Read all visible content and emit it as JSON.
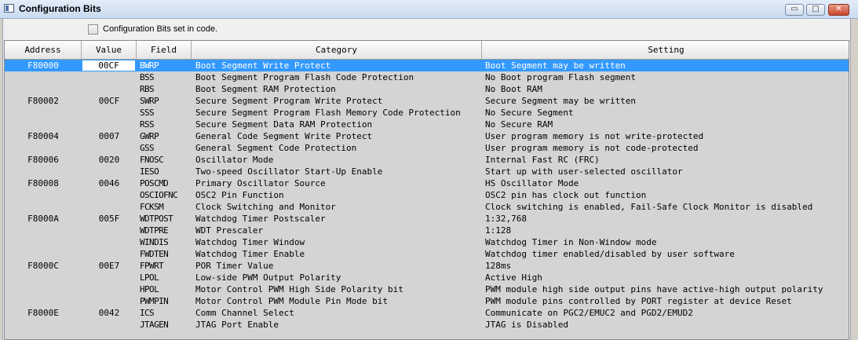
{
  "window": {
    "title": "Configuration Bits",
    "buttons": [
      "▭",
      "□",
      "✕"
    ]
  },
  "options": {
    "config_in_code_label": "Configuration Bits set in code.",
    "config_in_code_checked": false
  },
  "table": {
    "columns": [
      "Address",
      "Value",
      "Field",
      "Category",
      "Setting"
    ],
    "selected_row": 0,
    "rows": [
      {
        "address": "F80000",
        "value": "00CF",
        "field": "BWRP",
        "category": "Boot Segment Write Protect",
        "setting": "Boot Segment may be written"
      },
      {
        "address": "",
        "value": "",
        "field": "BSS",
        "category": "Boot Segment Program Flash Code Protection",
        "setting": "No Boot program Flash segment"
      },
      {
        "address": "",
        "value": "",
        "field": "RBS",
        "category": "Boot Segment RAM Protection",
        "setting": "No Boot RAM"
      },
      {
        "address": "F80002",
        "value": "00CF",
        "field": "SWRP",
        "category": "Secure Segment Program Write Protect",
        "setting": "Secure Segment may be written"
      },
      {
        "address": "",
        "value": "",
        "field": "SSS",
        "category": "Secure Segment Program Flash Memory Code Protection",
        "setting": "No Secure Segment"
      },
      {
        "address": "",
        "value": "",
        "field": "RSS",
        "category": "Secure Segment Data RAM Protection",
        "setting": "No Secure RAM"
      },
      {
        "address": "F80004",
        "value": "0007",
        "field": "GWRP",
        "category": "General Code Segment Write Protect",
        "setting": "User program memory is not write-protected"
      },
      {
        "address": "",
        "value": "",
        "field": "GSS",
        "category": "General Segment Code Protection",
        "setting": "User program memory is not code-protected"
      },
      {
        "address": "F80006",
        "value": "0020",
        "field": "FNOSC",
        "category": "Oscillator Mode",
        "setting": "Internal Fast RC (FRC)"
      },
      {
        "address": "",
        "value": "",
        "field": "IESO",
        "category": "Two-speed Oscillator Start-Up Enable",
        "setting": "Start up with user-selected oscillator"
      },
      {
        "address": "F80008",
        "value": "0046",
        "field": "POSCMD",
        "category": "Primary Oscillator Source",
        "setting": "HS Oscillator Mode"
      },
      {
        "address": "",
        "value": "",
        "field": "OSCIOFNC",
        "category": "OSC2 Pin Function",
        "setting": "OSC2 pin has clock out function"
      },
      {
        "address": "",
        "value": "",
        "field": "FCKSM",
        "category": "Clock Switching and Monitor",
        "setting": "Clock switching is enabled, Fail-Safe Clock Monitor is disabled"
      },
      {
        "address": "F8000A",
        "value": "005F",
        "field": "WDTPOST",
        "category": "Watchdog Timer Postscaler",
        "setting": "1:32,768"
      },
      {
        "address": "",
        "value": "",
        "field": "WDTPRE",
        "category": "WDT Prescaler",
        "setting": "1:128"
      },
      {
        "address": "",
        "value": "",
        "field": "WINDIS",
        "category": "Watchdog Timer Window",
        "setting": "Watchdog Timer in Non-Window mode"
      },
      {
        "address": "",
        "value": "",
        "field": "FWDTEN",
        "category": "Watchdog Timer Enable",
        "setting": "Watchdog timer enabled/disabled by user software"
      },
      {
        "address": "F8000C",
        "value": "00E7",
        "field": "FPWRT",
        "category": "POR Timer Value",
        "setting": "128ms"
      },
      {
        "address": "",
        "value": "",
        "field": "LPOL",
        "category": "Low-side PWM Output Polarity",
        "setting": "Active High"
      },
      {
        "address": "",
        "value": "",
        "field": "HPOL",
        "category": "Motor Control PWM High Side Polarity bit",
        "setting": "PWM module high side output pins have active-high output polarity"
      },
      {
        "address": "",
        "value": "",
        "field": "PWMPIN",
        "category": "Motor Control PWM Module Pin Mode bit",
        "setting": "PWM module pins controlled by PORT register at device Reset"
      },
      {
        "address": "F8000E",
        "value": "0042",
        "field": "ICS",
        "category": "Comm Channel Select",
        "setting": "Communicate on PGC2/EMUC2 and PGD2/EMUD2"
      },
      {
        "address": "",
        "value": "",
        "field": "JTAGEN",
        "category": "JTAG Port Enable",
        "setting": "JTAG is Disabled"
      }
    ]
  }
}
